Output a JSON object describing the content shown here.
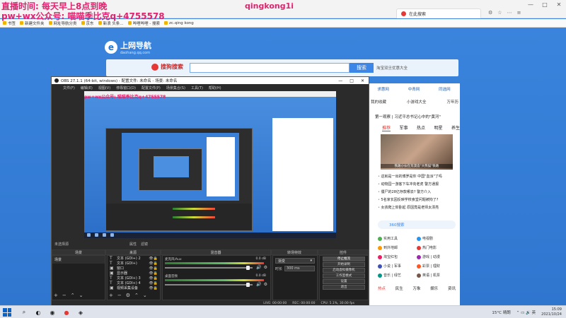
{
  "overlay": {
    "line1": "直播时间: 每天早上8点到晚",
    "line2": "pw+wx公众号: 喵喵季比克q+4755578",
    "watermark": "qingkong1i"
  },
  "browser": {
    "tab_title": "在此搜索",
    "window_controls": [
      "—",
      "□",
      "✕"
    ],
    "toolbar_icons": [
      "⚙",
      "☆",
      "⋯",
      "≡"
    ],
    "bookmarks": [
      "书签",
      "新建文件夹",
      "网址导航分类",
      "京东",
      "新浪 头条...",
      "哔哩哔哩 - 搜索",
      "zc.qing kong"
    ]
  },
  "webpage": {
    "logo_text": "上网导航",
    "logo_sub": "daohang.qq.com",
    "search_engine": "搜狗搜索",
    "search_button": "搜索",
    "search_hint": "淘宝双旦优惠大全",
    "nav_links": [
      "求惠网",
      "中青网",
      "同选网"
    ],
    "top_row": [
      "我的收藏",
      "小游戏大全",
      "万年历"
    ],
    "headline": "第一观察 | 习近平总书记心中的\"黄河\"",
    "tabs": [
      "推荐",
      "军事",
      "热点",
      "明星",
      "养生"
    ],
    "image_caption": "铁路小伙在荒漠造\"大熊猫\"铁路",
    "news": [
      "这就是一出的博罗是你 中国\"血派\"了吗",
      "动物园一游客下车冲向老虎 警方通报",
      "僵尸的28亿存款哪去? 警方介入",
      "5名家长因反映学校食堂问题被拘了?",
      "女孩爬上仰卧起 原因竟是老师太漂亮"
    ],
    "panel_search": "360搜索",
    "grid": [
      {
        "label": "实用工具",
        "color": "#4caf50"
      },
      {
        "label": "电视剧",
        "color": "#2196f3"
      },
      {
        "label": "到外地邮",
        "color": "#ff9800"
      },
      {
        "label": "热门电影",
        "color": "#e53935"
      },
      {
        "label": "淘宝红包",
        "color": "#e91e63"
      },
      {
        "label": "游戏 | 动漫",
        "color": "#9c27b0"
      },
      {
        "label": "小说 | 军事",
        "color": "#3f51b5"
      },
      {
        "label": "彩票 | 理财",
        "color": "#ff5722"
      },
      {
        "label": "音乐 | 绿艺",
        "color": "#009688"
      },
      {
        "label": "英语 | 机票",
        "color": "#795548"
      }
    ],
    "bottom_tabs": [
      "热点",
      "民生",
      "万象",
      "娱乐",
      "资讯"
    ]
  },
  "obs": {
    "title": "OBS 27.1.1 (64-bit, windows) - 配置文件: 未命名 - 场景: 未命名",
    "menu": [
      "文件(F)",
      "编辑(E)",
      "视图(V)",
      "停靠窗口(D)",
      "配置文件(P)",
      "场景集合(S)",
      "工具(T)",
      "帮助(H)"
    ],
    "preview_overlay": "pw+wx公众号: 喵喵季比克q+4755578",
    "source_label": "未选择源",
    "properties_label": "属性",
    "filters_label": "滤镜",
    "dock_headers": [
      "场景",
      "来源",
      "混音器",
      "转场特效",
      "控件"
    ],
    "scenes": [
      "场景"
    ],
    "sources": [
      {
        "icon": "T",
        "name": "文本 (GDI+) 2"
      },
      {
        "icon": "T",
        "name": "文本 (GDI+)"
      },
      {
        "icon": "▣",
        "name": "窗口"
      },
      {
        "icon": "▣",
        "name": "显示器"
      },
      {
        "icon": "T",
        "name": "文本 (GDI+) 3"
      },
      {
        "icon": "T",
        "name": "文本 (GDI+) 4"
      },
      {
        "icon": "▣",
        "name": "视频采集设备"
      }
    ],
    "mixer": [
      {
        "name": "麦克风/Aux",
        "db": "0.0 dB"
      },
      {
        "name": "桌面音频",
        "db": "0.0 dB"
      }
    ],
    "transition": "渐变",
    "duration_label": "时长",
    "duration_value": "300 ms",
    "controls": [
      "停止推流",
      "开始录制",
      "启动虚拟摄像机",
      "工作室模式",
      "设置",
      "退出"
    ],
    "status": [
      "LIVE: 00:00:00",
      "REC: 00:00:00",
      "CPU: 5.1%, 30.00 fps"
    ]
  },
  "taskbar": {
    "icons": [
      "⊞",
      "⌕",
      "◐",
      "◉",
      "●",
      "◈"
    ],
    "weather": "15°C 晴朗",
    "time": "15:09",
    "date": "2021/10/24"
  }
}
